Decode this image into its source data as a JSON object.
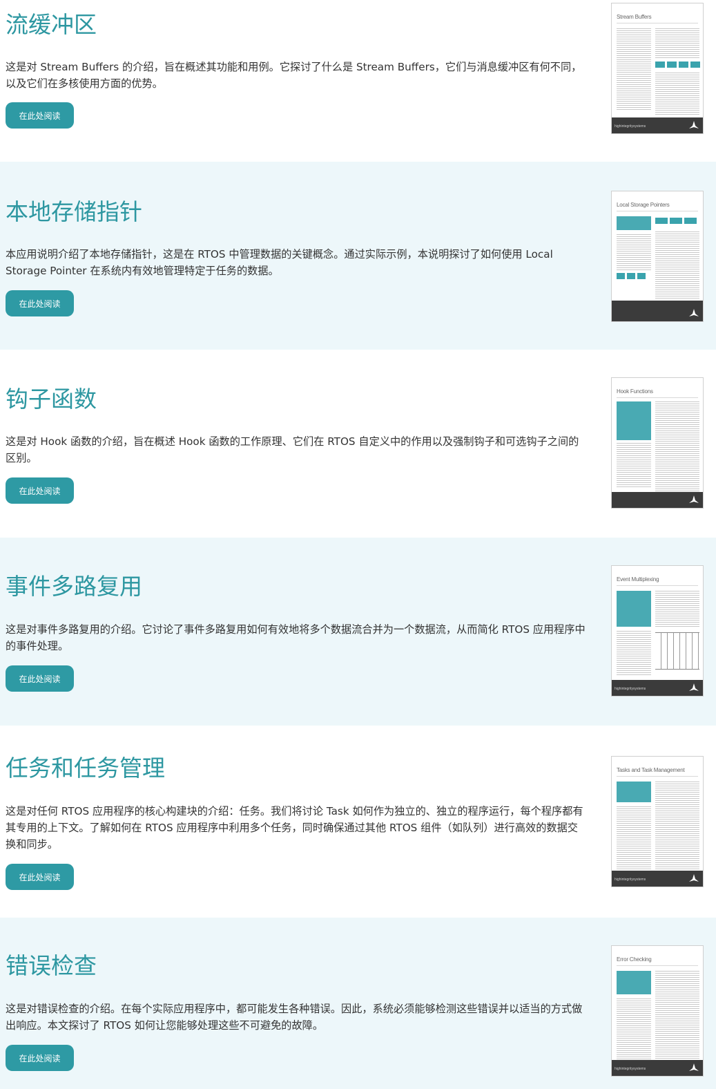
{
  "sections": [
    {
      "title": "流缓冲区",
      "description": "这是对 Stream Buffers 的介绍，旨在概述其功能和用例。它探讨了什么是 Stream Buffers，它们与消息缓冲区有何不同，以及它们在多核使用方面的优势。",
      "button_label": "在此处阅读",
      "thumbnail": {
        "title": "Stream Buffers",
        "brand": "highintegritysystems"
      }
    },
    {
      "title": "本地存储指针",
      "description": "本应用说明介绍了本地存储指针，这是在 RTOS 中管理数据的关键概念。通过实际示例，本说明探讨了如何使用 Local Storage Pointer 在系统内有效地管理特定于任务的数据。",
      "button_label": "在此处阅读",
      "thumbnail": {
        "title": "Local Storage Pointers",
        "brand": ""
      }
    },
    {
      "title": "钩子函数",
      "description": "这是对 Hook 函数的介绍，旨在概述 Hook 函数的工作原理、它们在 RTOS 自定义中的作用以及强制钩子和可选钩子之间的区别。",
      "button_label": "在此处阅读",
      "thumbnail": {
        "title": "Hook Functions",
        "brand": ""
      }
    },
    {
      "title": "事件多路复用",
      "description": "这是对事件多路复用的介绍。它讨论了事件多路复用如何有效地将多个数据流合并为一个数据流，从而简化 RTOS 应用程序中的事件处理。",
      "button_label": "在此处阅读",
      "thumbnail": {
        "title": "Event Multiplexing",
        "brand": "highintegritysystems"
      }
    },
    {
      "title": "任务和任务管理",
      "description": "这是对任何 RTOS 应用程序的核心构建块的介绍：任务。我们将讨论 Task 如何作为独立的、独立的程序运行，每个程序都有其专用的上下文。了解如何在 RTOS 应用程序中利用多个任务，同时确保通过其他 RTOS 组件（如队列）进行高效的数据交换和同步。",
      "button_label": "在此处阅读",
      "thumbnail": {
        "title": "Tasks and Task Management",
        "brand": "highintegritysystems"
      }
    },
    {
      "title": "错误检查",
      "description": "这是对错误检查的介绍。在每个实际应用程序中，都可能发生各种错误。因此，系统必须能够检测这些错误并以适当的方式做出响应。本文探讨了 RTOS 如何让您能够处理这些不可避免的故障。",
      "button_label": "在此处阅读",
      "thumbnail": {
        "title": "Error Checking",
        "brand": "highintegritysystems"
      }
    }
  ],
  "colors": {
    "accent": "#2d97a1",
    "button": "#2e9aa4",
    "alt_background": "#edf7fa"
  }
}
